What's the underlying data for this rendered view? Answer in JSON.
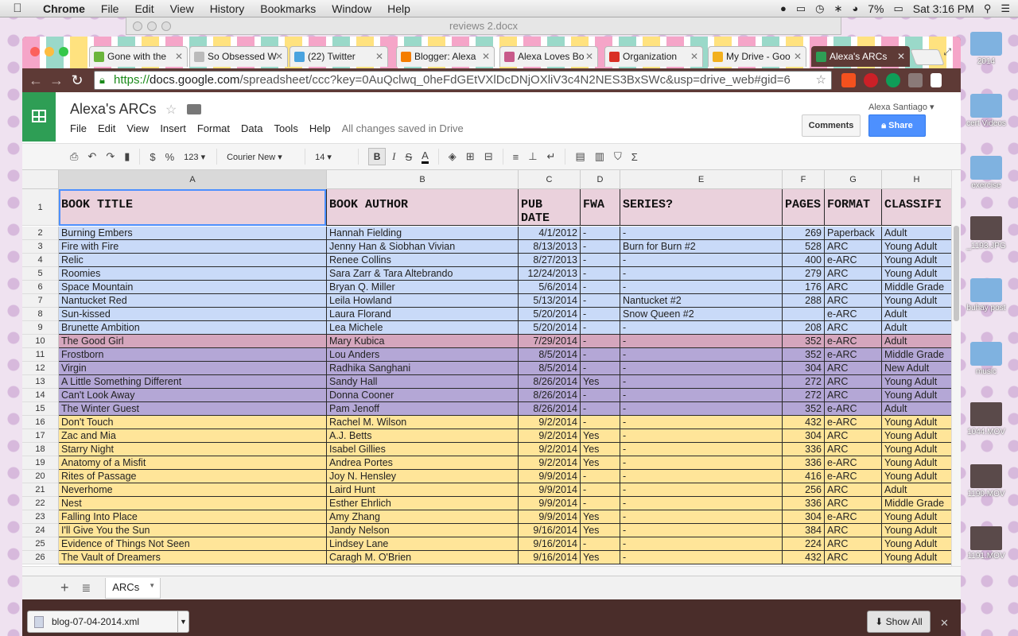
{
  "menubar": {
    "app": "Chrome",
    "items": [
      "File",
      "Edit",
      "View",
      "History",
      "Bookmarks",
      "Window",
      "Help"
    ],
    "battery": "7%",
    "clock": "Sat 3:16 PM"
  },
  "bg_window_title": "reviews 2.docx",
  "desktop_icons": [
    "2014",
    "cert Videos",
    "exercise",
    "_1193.JPG",
    "buhay post",
    "music",
    "1044.MOV",
    "1190.MOV",
    "1191.MOV"
  ],
  "tabs": [
    {
      "label": "Gone with the",
      "color": "#6bb53c"
    },
    {
      "label": "So Obsessed W",
      "color": "#bbbbbb"
    },
    {
      "label": "(22) Twitter",
      "color": "#4aa3df"
    },
    {
      "label": "Blogger: Alexa",
      "color": "#f57d00"
    },
    {
      "label": "Alexa Loves Bo",
      "color": "#c85a8a"
    },
    {
      "label": "Organization",
      "color": "#d93025"
    },
    {
      "label": "My Drive - Goo",
      "color": "#f2b01e"
    },
    {
      "label": "Alexa's ARCs",
      "color": "#2e9e55"
    }
  ],
  "url": {
    "scheme": "https://",
    "host": "docs.google.com",
    "path": "/spreadsheet/ccc?key=0AuQclwq_0heFdGEtVXlDcDNjOXliV3c4N2NES3BxSWc&usp=drive_web#gid=6"
  },
  "doc": {
    "title": "Alexa's ARCs",
    "menus": [
      "File",
      "Edit",
      "View",
      "Insert",
      "Format",
      "Data",
      "Tools",
      "Help"
    ],
    "saved": "All changes saved in Drive",
    "user": "Alexa Santiago",
    "comments": "Comments",
    "share": "Share"
  },
  "format_toolbar": {
    "currency": "$",
    "percent": "%",
    "number": "123",
    "font": "Courier New",
    "size": "14"
  },
  "columns": [
    "A",
    "B",
    "C",
    "D",
    "E",
    "F",
    "G",
    "H"
  ],
  "header_row": [
    "BOOK TITLE",
    "BOOK AUTHOR",
    "PUB DATE",
    "FWA",
    "SERIES?",
    "PAGES",
    "FORMAT",
    "CLASSIFI"
  ],
  "rows": [
    {
      "n": "2",
      "c": "#c9daf8",
      "v": [
        "Burning Embers",
        "Hannah Fielding",
        "4/1/2012",
        "-",
        "-",
        "269",
        "Paperback",
        "Adult"
      ]
    },
    {
      "n": "3",
      "c": "#c9daf8",
      "v": [
        "Fire with Fire",
        "Jenny Han & Siobhan Vivian",
        "8/13/2013",
        "-",
        "Burn for Burn #2",
        "528",
        "ARC",
        "Young Adult"
      ]
    },
    {
      "n": "4",
      "c": "#c9daf8",
      "v": [
        "Relic",
        "Renee Collins",
        "8/27/2013",
        "-",
        "-",
        "400",
        "e-ARC",
        "Young Adult"
      ]
    },
    {
      "n": "5",
      "c": "#c9daf8",
      "v": [
        "Roomies",
        "Sara Zarr & Tara Altebrando",
        "12/24/2013",
        "-",
        "-",
        "279",
        "ARC",
        "Young Adult"
      ]
    },
    {
      "n": "6",
      "c": "#c9daf8",
      "v": [
        "Space Mountain",
        "Bryan Q. Miller",
        "5/6/2014",
        "-",
        "-",
        "176",
        "ARC",
        "Middle Grade"
      ]
    },
    {
      "n": "7",
      "c": "#c9daf8",
      "v": [
        "Nantucket Red",
        "Leila Howland",
        "5/13/2014",
        "-",
        "Nantucket #2",
        "288",
        "ARC",
        "Young Adult"
      ]
    },
    {
      "n": "8",
      "c": "#c9daf8",
      "v": [
        "Sun-kissed",
        "Laura Florand",
        "5/20/2014",
        "-",
        "Snow Queen #2",
        "",
        "e-ARC",
        "Adult"
      ]
    },
    {
      "n": "9",
      "c": "#c9daf8",
      "v": [
        "Brunette Ambition",
        "Lea Michele",
        "5/20/2014",
        "-",
        "-",
        "208",
        "ARC",
        "Adult"
      ]
    },
    {
      "n": "10",
      "c": "#d5a6bd",
      "v": [
        "The Good Girl",
        "Mary Kubica",
        "7/29/2014",
        "-",
        "-",
        "352",
        "e-ARC",
        "Adult"
      ]
    },
    {
      "n": "11",
      "c": "#b4a7d6",
      "v": [
        "Frostborn",
        "Lou Anders",
        "8/5/2014",
        "-",
        "-",
        "352",
        "e-ARC",
        "Middle Grade"
      ]
    },
    {
      "n": "12",
      "c": "#b4a7d6",
      "v": [
        "Virgin",
        "Radhika Sanghani",
        "8/5/2014",
        "-",
        "-",
        "304",
        "ARC",
        "New Adult"
      ]
    },
    {
      "n": "13",
      "c": "#b4a7d6",
      "v": [
        "A Little Something Different",
        "Sandy Hall",
        "8/26/2014",
        "Yes",
        "-",
        "272",
        "ARC",
        "Young Adult"
      ]
    },
    {
      "n": "14",
      "c": "#b4a7d6",
      "v": [
        "Can't Look Away",
        "Donna Cooner",
        "8/26/2014",
        "-",
        "-",
        "272",
        "ARC",
        "Young Adult"
      ]
    },
    {
      "n": "15",
      "c": "#b4a7d6",
      "v": [
        "The Winter Guest",
        "Pam Jenoff",
        "8/26/2014",
        "-",
        "-",
        "352",
        "e-ARC",
        "Adult"
      ]
    },
    {
      "n": "16",
      "c": "#ffe599",
      "v": [
        "Don't Touch",
        "Rachel M. Wilson",
        "9/2/2014",
        "-",
        "-",
        "432",
        "e-ARC",
        "Young Adult"
      ]
    },
    {
      "n": "17",
      "c": "#ffe599",
      "v": [
        "Zac and Mia",
        "A.J. Betts",
        "9/2/2014",
        "Yes",
        "-",
        "304",
        "ARC",
        "Young Adult"
      ]
    },
    {
      "n": "18",
      "c": "#ffe599",
      "v": [
        "Starry Night",
        "Isabel Gillies",
        "9/2/2014",
        "Yes",
        "-",
        "336",
        "ARC",
        "Young Adult"
      ]
    },
    {
      "n": "19",
      "c": "#ffe599",
      "v": [
        "Anatomy of a Misfit",
        "Andrea Portes",
        "9/2/2014",
        "Yes",
        "-",
        "336",
        "e-ARC",
        "Young Adult"
      ]
    },
    {
      "n": "20",
      "c": "#ffe599",
      "v": [
        "Rites of Passage",
        "Joy N. Hensley",
        "9/9/2014",
        "-",
        "-",
        "416",
        "e-ARC",
        "Young Adult"
      ]
    },
    {
      "n": "21",
      "c": "#ffe599",
      "v": [
        "Neverhome",
        "Laird Hunt",
        "9/9/2014",
        "-",
        "-",
        "256",
        "ARC",
        "Adult"
      ]
    },
    {
      "n": "22",
      "c": "#ffe599",
      "v": [
        "Nest",
        "Esther Ehrlich",
        "9/9/2014",
        "-",
        "-",
        "336",
        "ARC",
        "Middle Grade"
      ]
    },
    {
      "n": "23",
      "c": "#ffe599",
      "v": [
        "Falling Into Place",
        "Amy Zhang",
        "9/9/2014",
        "Yes",
        "-",
        "304",
        "e-ARC",
        "Young Adult"
      ]
    },
    {
      "n": "24",
      "c": "#ffe599",
      "v": [
        "I'll Give You the Sun",
        "Jandy Nelson",
        "9/16/2014",
        "Yes",
        "-",
        "384",
        "ARC",
        "Young Adult"
      ]
    },
    {
      "n": "25",
      "c": "#ffe599",
      "v": [
        "Evidence of Things Not Seen",
        "Lindsey Lane",
        "9/16/2014",
        "-",
        "-",
        "224",
        "ARC",
        "Young Adult"
      ]
    },
    {
      "n": "26",
      "c": "#ffe599",
      "v": [
        "The Vault of Dreamers",
        "Caragh M. O'Brien",
        "9/16/2014",
        "Yes",
        "-",
        "432",
        "ARC",
        "Young Adult"
      ]
    }
  ],
  "sheet_tab": "ARCs",
  "download": {
    "file": "blog-07-04-2014.xml",
    "show_all": "Show All"
  }
}
